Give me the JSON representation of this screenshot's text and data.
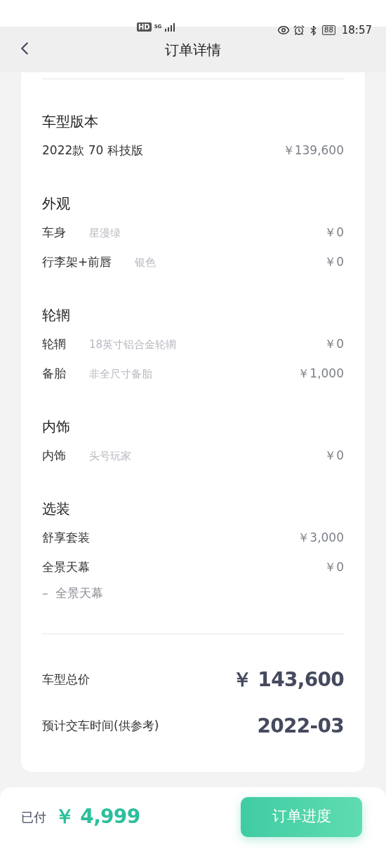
{
  "status_bar": {
    "hd": "HD",
    "network": "5G",
    "battery": "88",
    "time": "18:57"
  },
  "header": {
    "title": "订单详情"
  },
  "sections": [
    {
      "title": "车型版本",
      "items": [
        {
          "name": "2022款 70 科技版",
          "price": "￥139,600"
        }
      ]
    },
    {
      "title": "外观",
      "items": [
        {
          "name": "车身",
          "option": "星漫绿",
          "price": "￥0"
        },
        {
          "name": "行李架+前唇",
          "option": "银色",
          "price": "￥0"
        }
      ]
    },
    {
      "title": "轮辋",
      "items": [
        {
          "name": "轮辋",
          "option": "18英寸铝合金轮辋",
          "price": "￥0"
        },
        {
          "name": "备胎",
          "option": "非全尺寸备胎",
          "price": "￥1,000"
        }
      ]
    },
    {
      "title": "内饰",
      "items": [
        {
          "name": "内饰",
          "option": "头号玩家",
          "price": "￥0"
        }
      ]
    },
    {
      "title": "选装",
      "items": [
        {
          "name": "舒享套装",
          "price": "￥3,000"
        },
        {
          "name": "全景天幕",
          "price": "￥0",
          "sub": "–  全景天幕"
        }
      ]
    }
  ],
  "totals": [
    {
      "label": "车型总价",
      "value": "￥ 143,600"
    },
    {
      "label": "预计交车时间(供参考)",
      "value": "2022-03"
    }
  ],
  "footer": {
    "paid_label": "已付",
    "paid_amount": "￥ 4,999",
    "button": "订单进度"
  }
}
